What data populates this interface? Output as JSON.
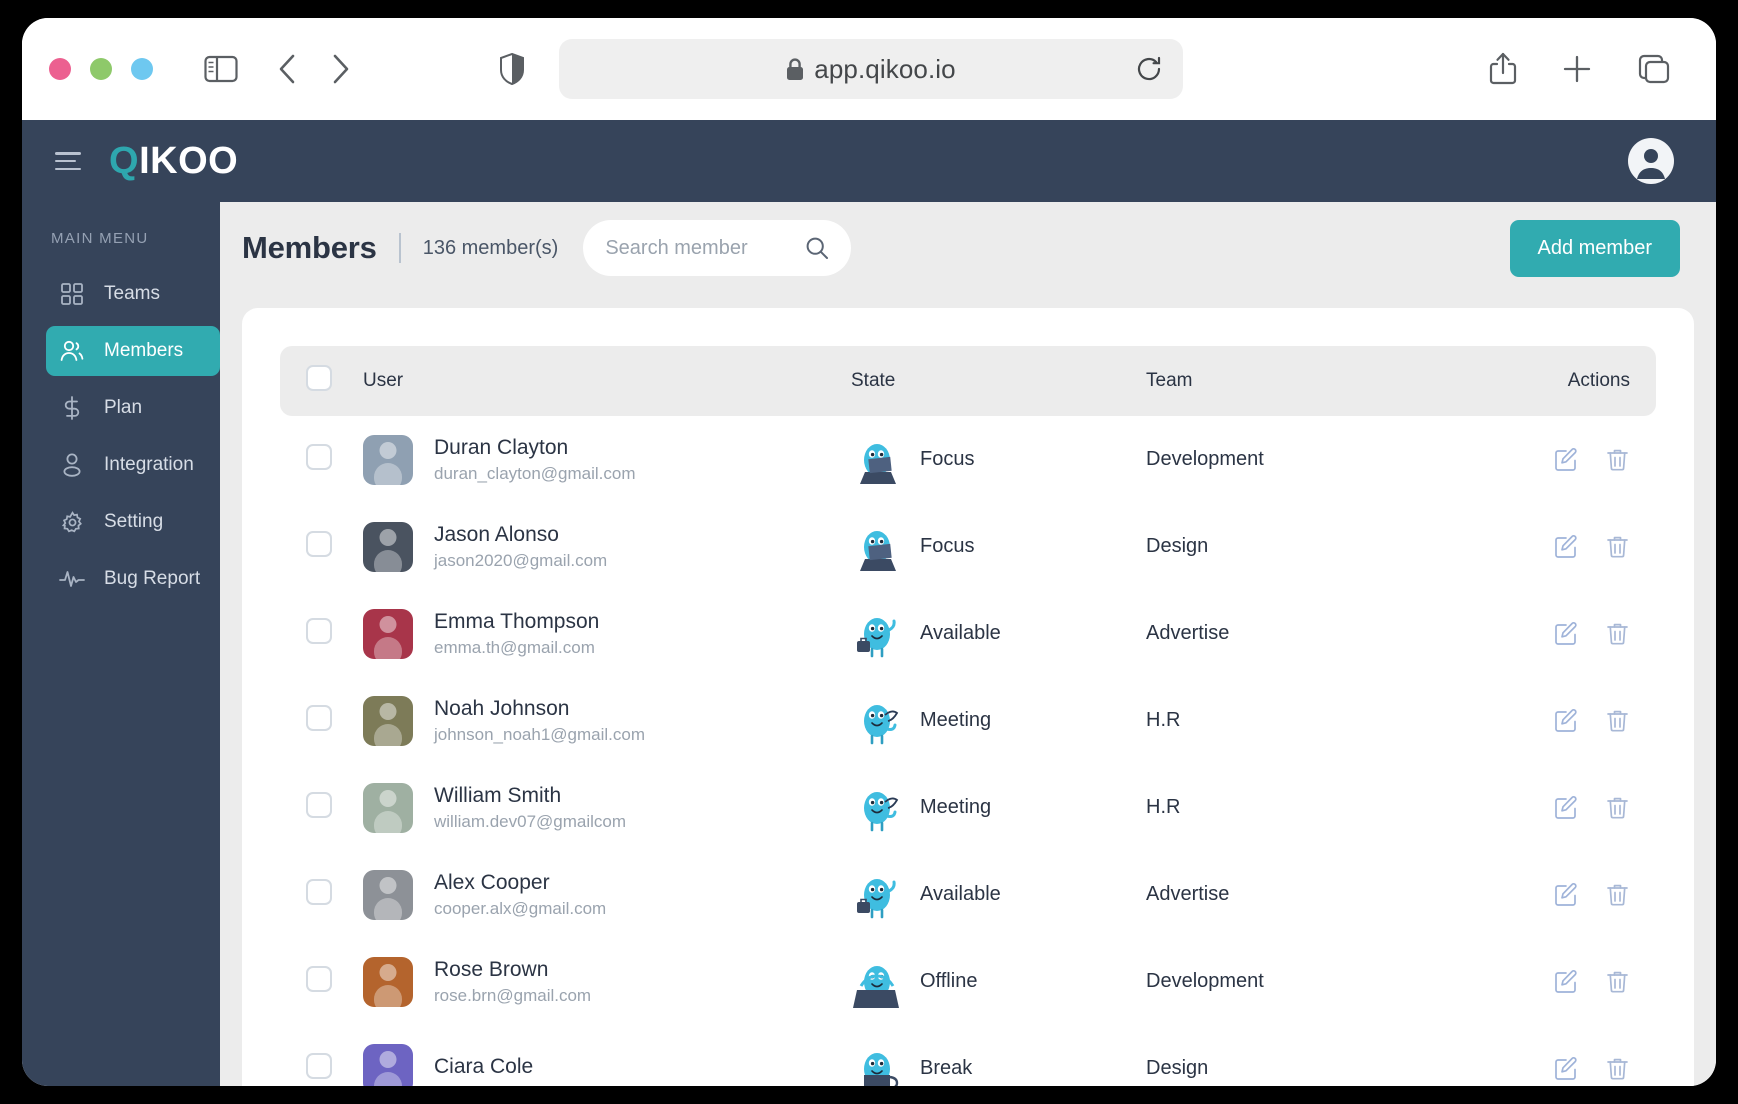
{
  "browser": {
    "url": "app.qikoo.io",
    "lock_icon": "lock-icon",
    "traffic_lights": [
      "close-red",
      "minimize-yellow",
      "maximize-green"
    ],
    "icons": {
      "sidebar_toggle": "sidebar-toggle-icon",
      "back": "chevron-left-icon",
      "forward": "chevron-right-icon",
      "shield": "shield-icon",
      "reload": "reload-icon",
      "share": "share-icon",
      "new_tab": "plus-icon",
      "tabs": "tabs-icon"
    }
  },
  "app_header": {
    "menu_icon": "hamburger-icon",
    "brand_first": "Q",
    "brand_rest": "IKOO",
    "avatar_icon": "user-avatar-icon"
  },
  "sidebar": {
    "caption": "MAIN MENU",
    "items": [
      {
        "label": "Teams",
        "icon": "grid-icon",
        "active": false
      },
      {
        "label": "Members",
        "icon": "users-icon",
        "active": true
      },
      {
        "label": "Plan",
        "icon": "dollar-icon",
        "active": false
      },
      {
        "label": "Integration",
        "icon": "person-icon",
        "active": false
      },
      {
        "label": "Setting",
        "icon": "gear-icon",
        "active": false
      },
      {
        "label": "Bug Report",
        "icon": "activity-icon",
        "active": false
      }
    ]
  },
  "page": {
    "title": "Members",
    "count_text": "136 member(s)",
    "search_placeholder": "Search member",
    "search_value": "",
    "search_icon": "search-icon",
    "add_button": "Add member"
  },
  "table": {
    "columns": [
      "User",
      "State",
      "Team",
      "Actions"
    ],
    "select_all_checked": false,
    "action_icons": [
      "edit-icon",
      "trash-icon"
    ],
    "rows": [
      {
        "name": "Duran Clayton",
        "email": "duran_clayton@gmail.com",
        "state": "Focus",
        "team": "Development",
        "avatar_color": "#8fa0b2",
        "state_kind": "focus"
      },
      {
        "name": "Jason Alonso",
        "email": "jason2020@gmail.com",
        "state": "Focus",
        "team": "Design",
        "avatar_color": "#4a5360",
        "state_kind": "focus"
      },
      {
        "name": "Emma Thompson",
        "email": "emma.th@gmail.com",
        "state": "Available",
        "team": "Advertise",
        "avatar_color": "#a8354a",
        "state_kind": "available"
      },
      {
        "name": "Noah Johnson",
        "email": "johnson_noah1@gmail.com",
        "state": "Meeting",
        "team": "H.R",
        "avatar_color": "#7d7b58",
        "state_kind": "meeting"
      },
      {
        "name": "William Smith",
        "email": "william.dev07@gmailcom",
        "state": "Meeting",
        "team": "H.R",
        "avatar_color": "#9fb0a2",
        "state_kind": "meeting"
      },
      {
        "name": "Alex Cooper",
        "email": "cooper.alx@gmail.com",
        "state": "Available",
        "team": "Advertise",
        "avatar_color": "#8d9197",
        "state_kind": "available"
      },
      {
        "name": "Rose Brown",
        "email": "rose.brn@gmail.com",
        "state": "Offline",
        "team": "Development",
        "avatar_color": "#b4642d",
        "state_kind": "offline"
      },
      {
        "name": "Ciara Cole",
        "email": "",
        "state": "Break",
        "team": "Design",
        "avatar_color": "#6d64c2",
        "state_kind": "break"
      }
    ]
  },
  "colors": {
    "brand_teal": "#31abb0",
    "header_navy": "#36445a",
    "page_bg": "#ececec",
    "text_dark": "#2b3444"
  }
}
